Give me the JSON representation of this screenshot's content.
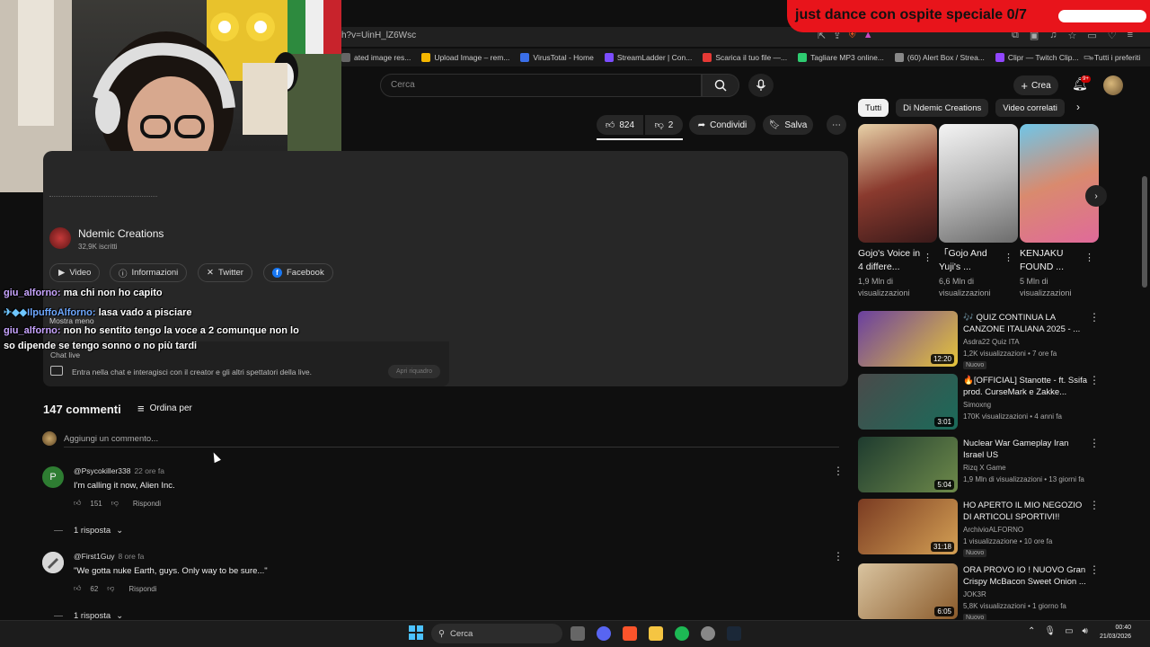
{
  "browser": {
    "url": "h?v=UinH_lZ6Wsc",
    "bookmarks": [
      {
        "label": "ated image res...",
        "color": "#666"
      },
      {
        "label": "Upload Image – rem...",
        "color": "#f5b700"
      },
      {
        "label": "VirusTotal - Home",
        "color": "#3a6ee8"
      },
      {
        "label": "StreamLadder | Con...",
        "color": "#7c4dff"
      },
      {
        "label": "Scarica il tuo file —...",
        "color": "#e53935"
      },
      {
        "label": "Tagliare MP3 online...",
        "color": "#2ecc71"
      },
      {
        "label": "(60) Alert Box / Strea...",
        "color": "#888"
      },
      {
        "label": "Clipr — Twitch Clip...",
        "color": "#9146ff"
      }
    ],
    "bookmarks_all": "Tutti i preferiti"
  },
  "overlay": {
    "banner": "just dance con ospite speciale 0/7"
  },
  "yt": {
    "search_placeholder": "Cerca",
    "create_label": "Crea",
    "notif_count": "9+",
    "likes": "824",
    "dislikes": "2",
    "share_label": "Condividi",
    "save_label": "Salva"
  },
  "channel": {
    "name": "Ndemic Creations",
    "subs": "32,9K iscritti"
  },
  "chips": [
    {
      "label": "Video",
      "icon": "video-icon"
    },
    {
      "label": "Informazioni",
      "icon": "info-icon"
    },
    {
      "label": "Twitter",
      "icon": "x-icon"
    },
    {
      "label": "Facebook",
      "icon": "facebook-icon"
    }
  ],
  "desc": {
    "show_less": "Mostra meno"
  },
  "chat": {
    "messages": [
      {
        "user": "giu_alforno:",
        "text": "ma chi non ho capito"
      },
      {
        "user": "IlpuffoAlforno:",
        "text": "lasa vado a pisciare"
      },
      {
        "user": "giu_alforno:",
        "text": "non ho sentito tengo la voce a 2 comunque non lo"
      },
      {
        "user": "",
        "text": "so dipende se tengo sonno o no più tardi"
      }
    ],
    "live_title": "Chat live",
    "entry_text": "Entra nella chat e interagisci con il creator e gli altri spettatori della live.",
    "open_button": "Apri riquadro"
  },
  "comments": {
    "count": "147 commenti",
    "sort": "Ordina per",
    "add_placeholder": "Aggiungi un commento...",
    "items": [
      {
        "avatar": "P",
        "avatar_color": "#2e7d32",
        "author": "@Psycokiller338",
        "time": "22 ore fa",
        "text": "I'm calling it now, Alien Inc.",
        "likes": "151",
        "reply": "Rispondi",
        "replies": "1 risposta"
      },
      {
        "avatar": "",
        "avatar_color": "#bbb",
        "author": "@First1Guy",
        "time": "8 ore fa",
        "text": "\"We gotta nuke Earth, guys. Only way to be sure...\"",
        "likes": "62",
        "reply": "Rispondi",
        "replies": "1 risposta"
      }
    ]
  },
  "sidebar": {
    "tabs": [
      "Tutti",
      "Di Ndemic Creations",
      "Video correlati"
    ],
    "shorts": [
      {
        "title": "Gojo's Voice in 4 differe...",
        "meta": "1,9 Mln di visualizzazioni"
      },
      {
        "title": "「Gojo And Yuji's ...",
        "meta": "6,6 Mln di visualizzazioni"
      },
      {
        "title": "KENJAKU FOUND ...",
        "meta": "5 Mln di visualizzazioni"
      }
    ],
    "videos": [
      {
        "title": "🎶 QUIZ CONTINUA LA CANZONE ITALIANA 2025 - ...",
        "channel": "Asdra22 Quiz ITA",
        "meta": "1,2K visualizzazioni • 7 ore fa",
        "badge": "Nuovo",
        "duration": "12:20",
        "c1": "#6a3fa0",
        "c2": "#e6c53a"
      },
      {
        "title": "🔥[OFFICIAL] Stanotte - ft. Ssifa prod. CurseMark e Zakke...",
        "channel": "Simoxng",
        "meta": "170K visualizzazioni • 4 anni fa",
        "badge": "",
        "duration": "3:01",
        "c1": "#4a4a4a",
        "c2": "#1a6b5a"
      },
      {
        "title": "Nuclear War Gameplay Iran Israel US",
        "channel": "Rizq X Game",
        "meta": "1,9 Mln di visualizzazioni • 13 giorni fa",
        "badge": "",
        "duration": "5:04",
        "c1": "#1e3b2f",
        "c2": "#6e8a4a"
      },
      {
        "title": "HO APERTO IL MIO NEGOZIO DI ARTICOLI SPORTIVI!!",
        "channel": "ArchivioALFORNO",
        "meta": "1 visualizzazione • 10 ore fa",
        "badge": "Nuovo",
        "duration": "31:18",
        "c1": "#7a3b22",
        "c2": "#d4a054"
      },
      {
        "title": "ORA PROVO IO ! NUOVO Gran Crispy McBacon Sweet Onion ...",
        "channel": "JOK3R",
        "meta": "5,8K visualizzazioni • 1 giorno fa",
        "badge": "Nuovo",
        "duration": "6:05",
        "c1": "#d9c4a0",
        "c2": "#8a5a2a"
      }
    ]
  },
  "taskbar": {
    "search": "Cerca",
    "time": "00:40",
    "date": "21/03/2026"
  }
}
